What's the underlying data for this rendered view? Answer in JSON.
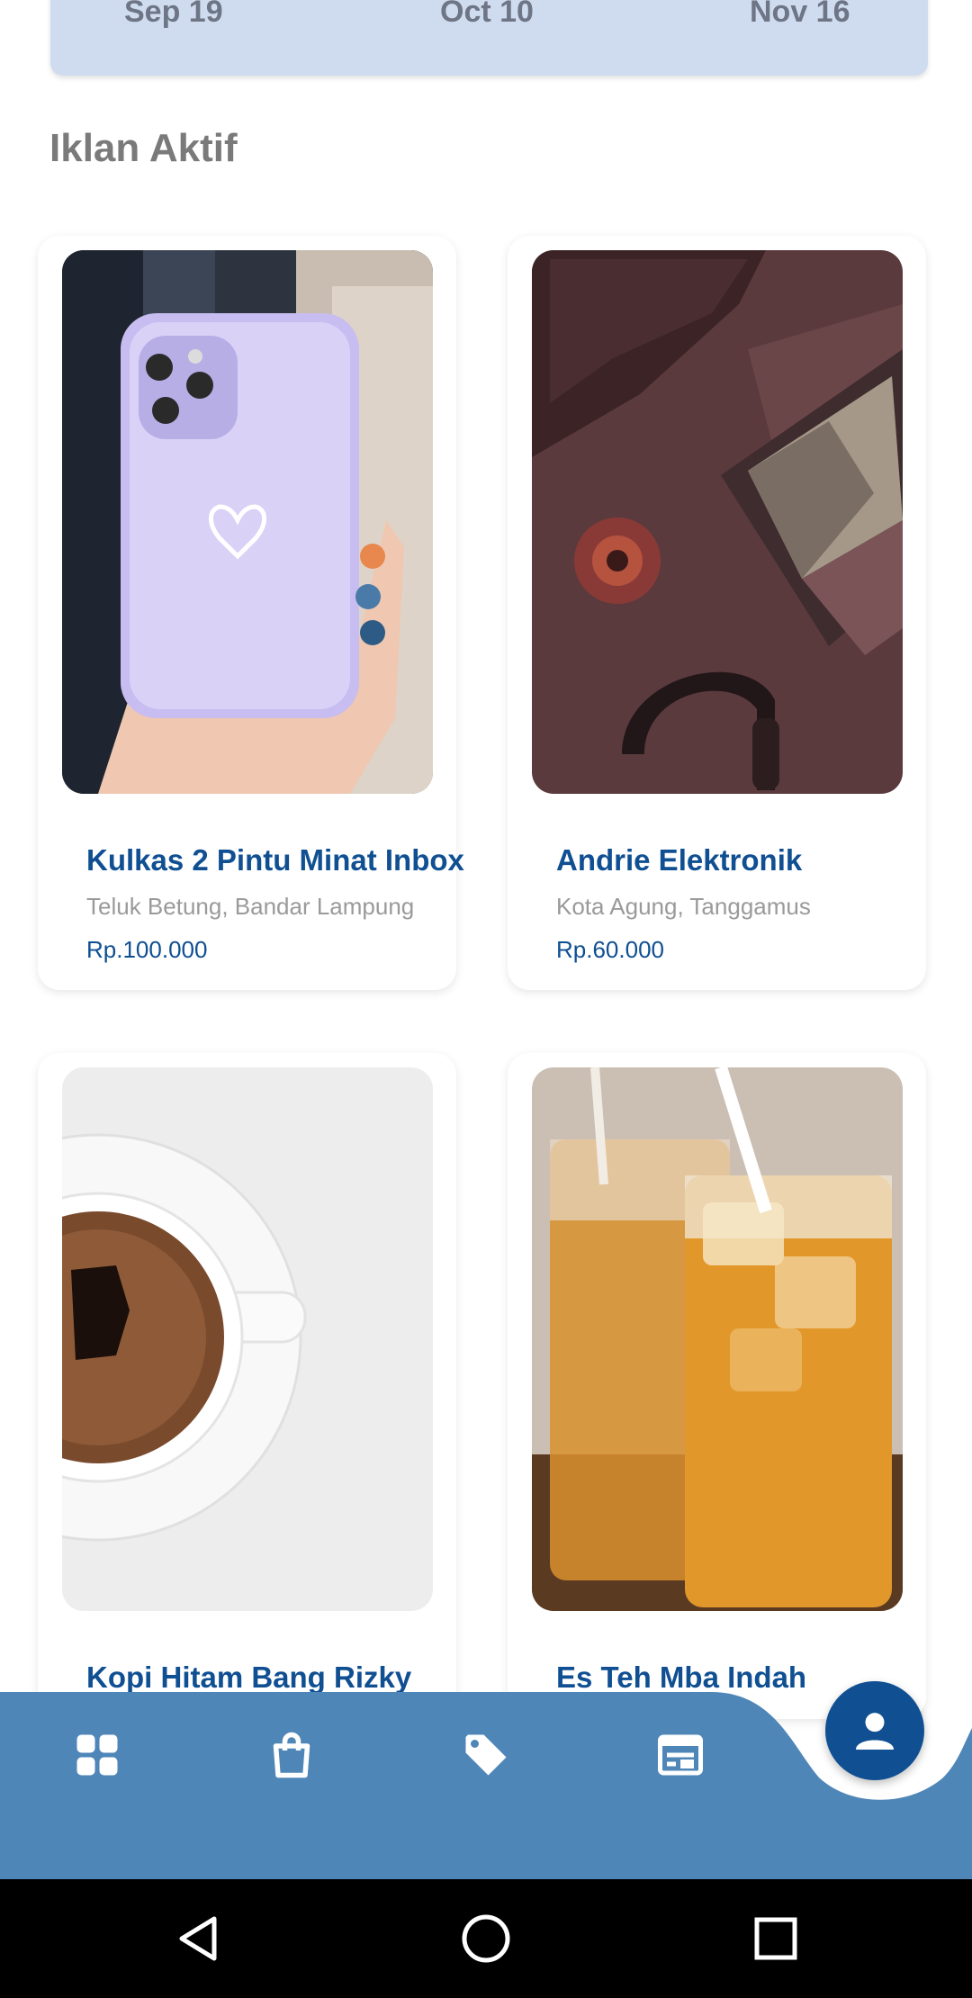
{
  "chart_axis": {
    "labels": [
      "Sep 19",
      "Oct 10",
      "Nov 16"
    ]
  },
  "section": {
    "title": "Iklan Aktif"
  },
  "listings": [
    {
      "name": "Kulkas 2 Pintu Minat Inbox",
      "location": "Teluk Betung, Bandar Lampung",
      "price": "Rp.100.000",
      "image": "purple-phone-case-photo"
    },
    {
      "name": "Andrie Elektronik",
      "location": "Kota Agung, Tanggamus",
      "price": "Rp.60.000",
      "image": "laptop-headphones-photo"
    },
    {
      "name": "Kopi Hitam Bang Rizky",
      "location": "",
      "price": "",
      "image": "coffee-cup-photo"
    },
    {
      "name": "Es Teh Mba Indah",
      "location": "",
      "price": "",
      "image": "iced-tea-photo"
    }
  ],
  "bottom_nav": {
    "items": [
      {
        "icon": "dashboard-icon"
      },
      {
        "icon": "shopping-bag-icon"
      },
      {
        "icon": "tag-icon"
      },
      {
        "icon": "listing-icon"
      },
      {
        "icon": "profile-icon"
      }
    ],
    "colors": {
      "bar": "#4f86b8",
      "active": "#0f4f92",
      "icon": "#ffffff"
    }
  },
  "system_nav": {
    "buttons": [
      "back-icon",
      "home-icon",
      "recents-icon"
    ]
  }
}
